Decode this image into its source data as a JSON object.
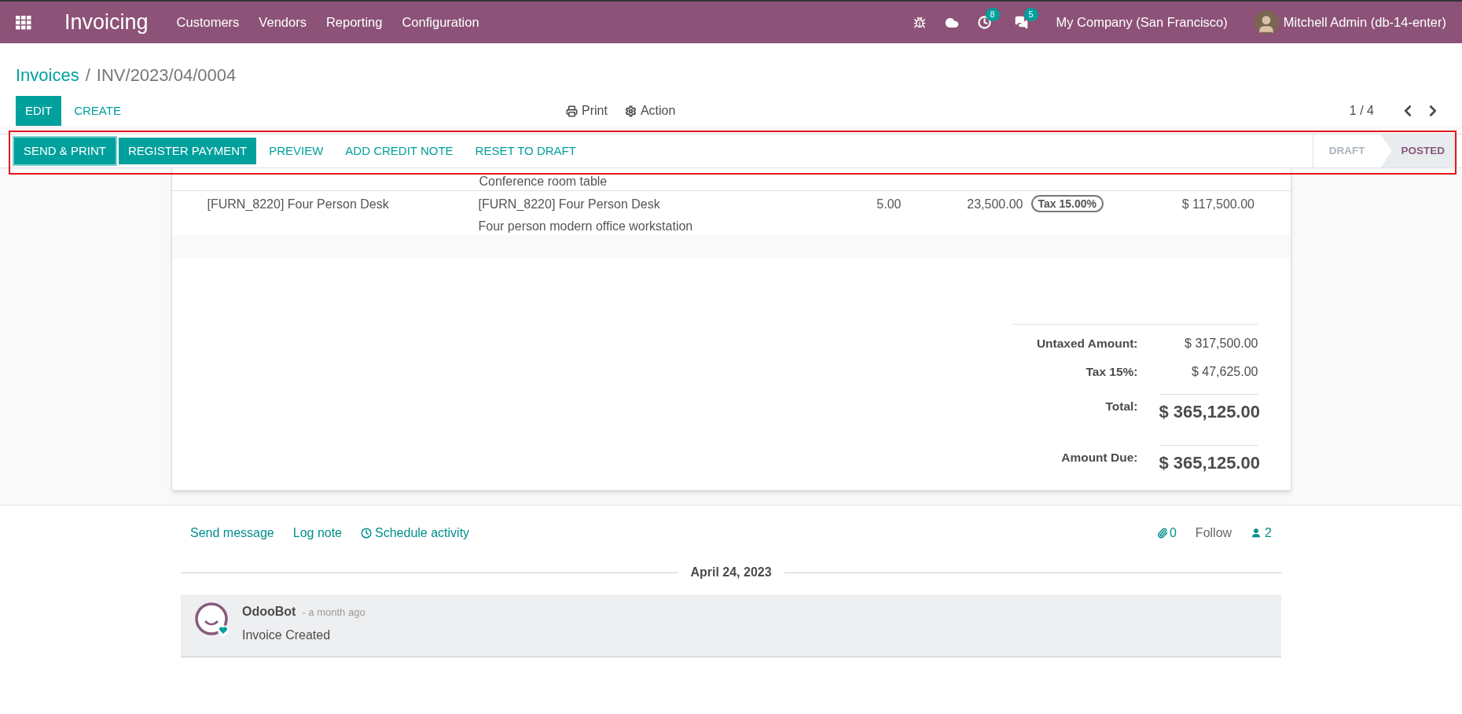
{
  "navbar": {
    "app_title": "Invoicing",
    "menu": [
      "Customers",
      "Vendors",
      "Reporting",
      "Configuration"
    ],
    "activity_count": "8",
    "message_count": "5",
    "company": "My Company (San Francisco)",
    "user": "Mitchell Admin (db-14-enter)"
  },
  "breadcrumb": {
    "parent": "Invoices",
    "separator": "/",
    "current": "INV/2023/04/0004"
  },
  "control_panel": {
    "buttons": [
      {
        "label": "EDIT",
        "kind": "primary"
      },
      {
        "label": "CREATE",
        "kind": "link"
      }
    ],
    "actions": [
      {
        "label": "Print",
        "kind": "print"
      },
      {
        "label": "Action",
        "kind": "gear"
      }
    ],
    "pager": "1 / 4"
  },
  "status_bar": {
    "buttons": [
      {
        "label": "SEND & PRINT",
        "kind": "primary",
        "focused": true
      },
      {
        "label": "REGISTER PAYMENT",
        "kind": "primary",
        "focused": false
      },
      {
        "label": "PREVIEW",
        "kind": "link",
        "focused": false
      },
      {
        "label": "ADD CREDIT NOTE",
        "kind": "link",
        "focused": false
      },
      {
        "label": "RESET TO DRAFT",
        "kind": "link",
        "focused": false
      }
    ],
    "stages": [
      {
        "label": "DRAFT",
        "selected": false
      },
      {
        "label": "POSTED",
        "selected": true
      }
    ]
  },
  "invoice_lines": {
    "previous_row_label": "Conference room table",
    "rows": [
      {
        "product": "[FURN_8220] Four Person Desk",
        "label": "[FURN_8220] Four Person Desk",
        "description": "Four person modern office workstation",
        "quantity": "5.00",
        "price": "23,500.00",
        "tax": "Tax 15.00%",
        "subtotal": "$ 117,500.00"
      }
    ]
  },
  "totals": [
    {
      "label": "Untaxed Amount:",
      "value": "$ 317,500.00",
      "kind": "plain"
    },
    {
      "label": "Tax 15%:",
      "value": "$ 47,625.00",
      "kind": "plain"
    },
    {
      "label": "Total:",
      "value": "$ 365,125.00",
      "kind": "grand"
    },
    {
      "label": "Amount Due:",
      "value": "$ 365,125.00",
      "kind": "grand"
    }
  ],
  "chatter": {
    "actions": [
      {
        "label": "Send message",
        "kind": "plain"
      },
      {
        "label": "Log note",
        "kind": "plain"
      },
      {
        "label": "Schedule activity",
        "kind": "clock"
      }
    ],
    "attachments": "0",
    "follow": "Follow",
    "followers": "2",
    "date": "April 24, 2023",
    "messages": [
      {
        "author": "OdooBot",
        "time": "- a month ago",
        "body": "Invoice Created"
      }
    ]
  }
}
